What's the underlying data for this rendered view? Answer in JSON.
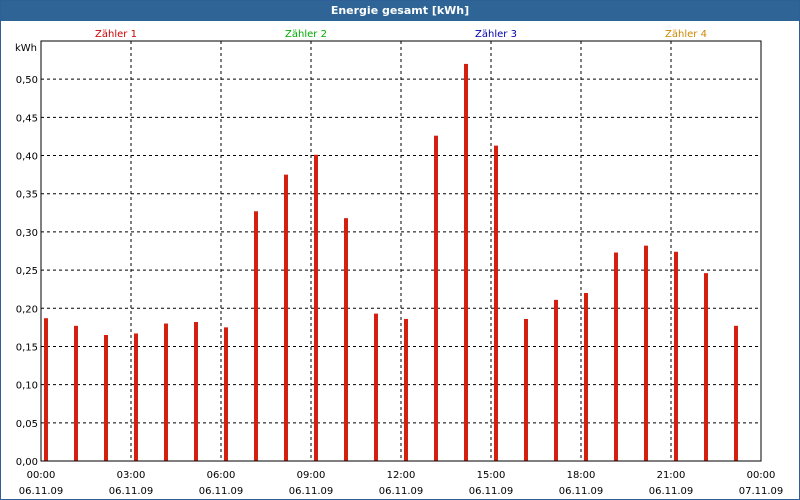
{
  "window": {
    "title": "Energie gesamt [kWh]"
  },
  "legend": [
    {
      "label": "Zähler 1",
      "color": "#cc0000"
    },
    {
      "label": "Zähler 2",
      "color": "#00aa00"
    },
    {
      "label": "Zähler 3",
      "color": "#0000aa"
    },
    {
      "label": "Zähler 4",
      "color": "#cc8800"
    }
  ],
  "colors": {
    "bar": "#d42010",
    "grid": "#000000",
    "plot_background": "#ffffff",
    "titlebar": "#2e6496"
  },
  "chart_data": {
    "type": "bar",
    "title": "Energie gesamt [kWh]",
    "ylabel": "kWh",
    "xlabel": "",
    "ylim": [
      0,
      0.55
    ],
    "y_ticks": [
      "0,00",
      "0,05",
      "0,10",
      "0,15",
      "0,20",
      "0,25",
      "0,30",
      "0,35",
      "0,40",
      "0,45",
      "0,50"
    ],
    "y_tick_values": [
      0,
      0.05,
      0.1,
      0.15,
      0.2,
      0.25,
      0.3,
      0.35,
      0.4,
      0.45,
      0.5
    ],
    "x_range_hours": [
      0,
      24
    ],
    "x_ticks": [
      {
        "time": "00:00",
        "date": "06.11.09"
      },
      {
        "time": "03:00",
        "date": "06.11.09"
      },
      {
        "time": "06:00",
        "date": "06.11.09"
      },
      {
        "time": "09:00",
        "date": "06.11.09"
      },
      {
        "time": "12:00",
        "date": "06.11.09"
      },
      {
        "time": "15:00",
        "date": "06.11.09"
      },
      {
        "time": "18:00",
        "date": "06.11.09"
      },
      {
        "time": "21:00",
        "date": "06.11.09"
      },
      {
        "time": "00:00",
        "date": "07.11.09"
      }
    ],
    "grid": true,
    "legend_position": "top",
    "series": [
      {
        "name": "Zähler 1",
        "x": [
          0,
          1,
          2,
          3,
          4,
          5,
          6,
          7,
          8,
          9,
          10,
          11,
          12,
          13,
          14,
          15,
          16,
          17,
          18,
          19,
          20,
          21,
          22,
          23
        ],
        "values": [
          0.187,
          0.177,
          0.165,
          0.167,
          0.18,
          0.182,
          0.175,
          0.327,
          0.375,
          0.401,
          0.318,
          0.193,
          0.186,
          0.426,
          0.52,
          0.413,
          0.186,
          0.211,
          0.22,
          0.273,
          0.282,
          0.274,
          0.246,
          0.177
        ]
      }
    ]
  }
}
